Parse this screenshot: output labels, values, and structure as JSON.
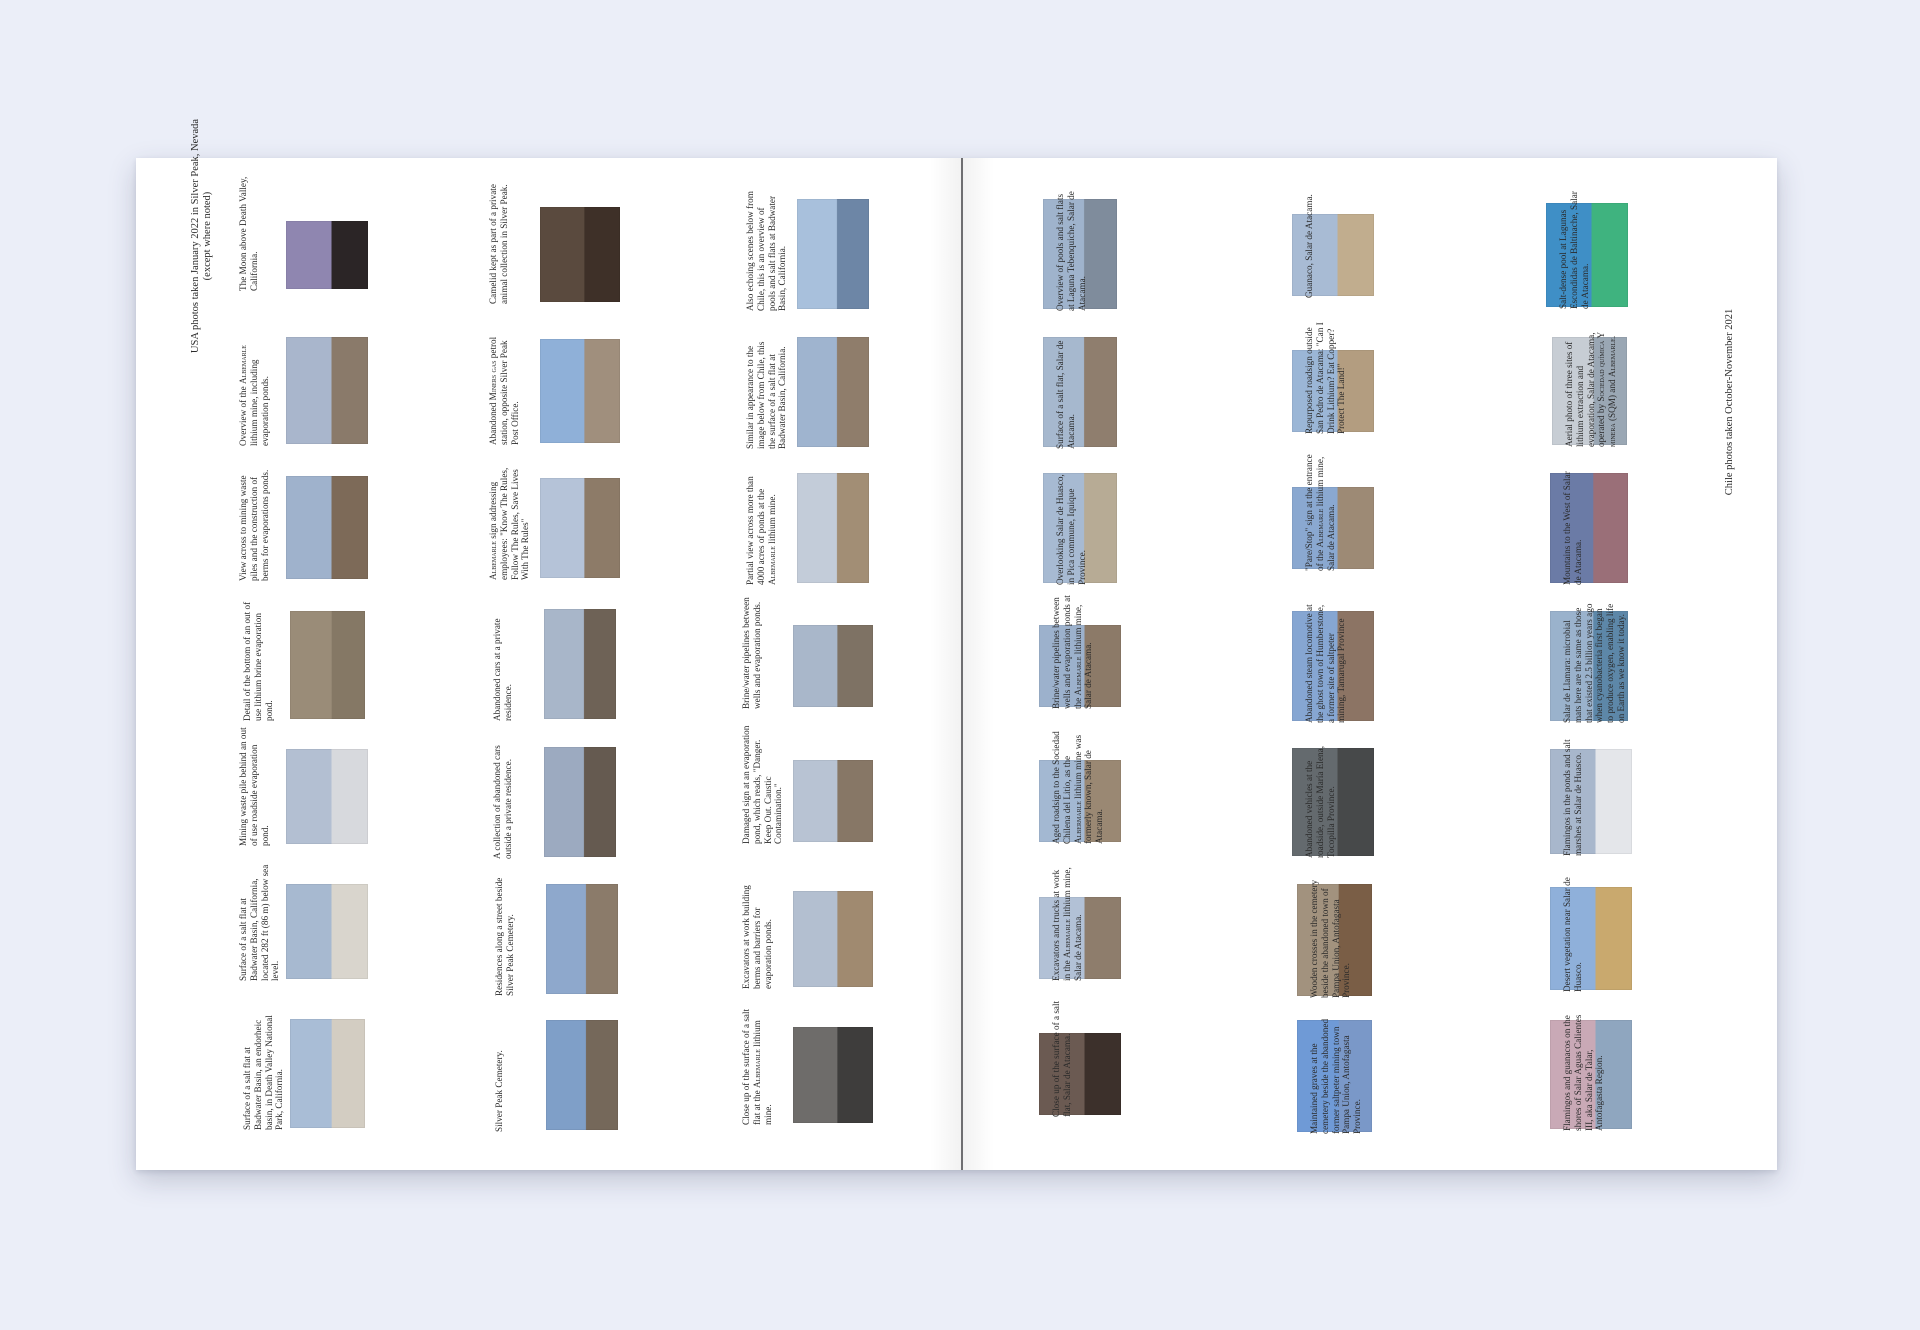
{
  "left_page": {
    "header_note": [
      "USA photos taken January 2022 in Silver Peak, Nevada",
      "(except where noted)"
    ],
    "items": [
      {
        "caption": "The Moon above Death Valley, California.",
        "photo": "moon-above-death-valley-photo",
        "sky": "#8f86b0",
        "ground": "#2b2526"
      },
      {
        "caption": "Overview of the ALBEMARLE lithium mine, including evaporation ponds.",
        "photo": "albemarle-mine-overview-photo",
        "sky": "#a9b6cc",
        "ground": "#8a7a6a"
      },
      {
        "caption": "View across to mining waste piles and the construction of berms for evaporations ponds.",
        "photo": "mining-waste-piles-view-photo",
        "sky": "#9fb2cc",
        "ground": "#7d6a58"
      },
      {
        "caption": "Detail of the bottom of an out of use lithium brine evaporation pond.",
        "photo": "evaporation-pond-bottom-photo",
        "sky": "#9a8c78",
        "ground": "#857865"
      },
      {
        "caption": "Mining waste pile behind an out of use roadside evaporation pond.",
        "photo": "roadside-evaporation-pond-photo",
        "sky": "#b3bfd2",
        "ground": "#d7d9dd"
      },
      {
        "caption": "Surface of a salt flat at Badwater Basin, California, located 282 ft (86 m) below sea level.",
        "photo": "badwater-basin-salt-flat-photo",
        "sky": "#a7b9d0",
        "ground": "#d9d5cd"
      },
      {
        "caption": "Surface of a salt flat at Badwater Basin, an endorheic basin, in Death Valley National Park, California.",
        "photo": "death-valley-salt-flat-photo",
        "sky": "#a9bdd6",
        "ground": "#d3cdc2"
      },
      {
        "caption": "Camelid kept as part of a private animal collection in Silver Peak.",
        "photo": "camelid-animal-collection-photo",
        "sky": "#5a4a3e",
        "ground": "#3e3028"
      },
      {
        "caption": "Abandoned MINERS GAS petrol station, opposite Silver Peak Post Office.",
        "photo": "abandoned-miners-gas-station-photo",
        "sky": "#8fb0d8",
        "ground": "#a08f7d"
      },
      {
        "caption": "ALBEMARLE sign addressing employees: \"Know The Rules, Follow The Rules, Save Lives With The Rules\"",
        "photo": "albemarle-sign-photo",
        "sky": "#b5c3d8",
        "ground": "#8d7b68"
      },
      {
        "caption": "Abandoned cars at a private residence.",
        "photo": "abandoned-cars-residence-photo",
        "sky": "#a8b6c9",
        "ground": "#6e6256"
      },
      {
        "caption": "A collection of abandoned cars outside a private residence.",
        "photo": "abandoned-cars-collection-photo",
        "sky": "#9caac0",
        "ground": "#655a50"
      },
      {
        "caption": "Residences along a street beside Silver Peak Cemetery.",
        "photo": "residences-street-photo",
        "sky": "#8ea8cc",
        "ground": "#8b7b6a"
      },
      {
        "caption": "Silver Peak Cemetery.",
        "photo": "silver-peak-cemetery-photo",
        "sky": "#7f9fc8",
        "ground": "#75685a"
      },
      {
        "caption": "Also echoing scenes below from Chile, this is an overview of pools and salt flats at Badwater Basin, California.",
        "photo": "badwater-pools-overview-photo",
        "sky": "#a8c0dc",
        "ground": "#6d86a6"
      },
      {
        "caption": "Similar in appearance to the image below from Chile, this the surface of a salt flat at Badwater Basin, California.",
        "photo": "badwater-surface-photo",
        "sky": "#9fb4cf",
        "ground": "#8f7d6b"
      },
      {
        "caption": "Partial view across more than 4000 acres of ponds at the ALBEMARLE lithium mine.",
        "photo": "albemarle-ponds-partial-view-photo",
        "sky": "#c3ccd9",
        "ground": "#a28e75"
      },
      {
        "caption": "Brine/water pipelines between wells and evaporation ponds.",
        "photo": "brine-water-pipelines-photo",
        "sky": "#a9b7ca",
        "ground": "#7e7264"
      },
      {
        "caption": "Damaged sign at an evaporation pond, which reads, \"Danger. Keep Out. Caustic Contamination.\"",
        "photo": "damaged-danger-sign-photo",
        "sky": "#b8c3d3",
        "ground": "#877766"
      },
      {
        "caption": "Excavators at work building berms and barriers for evaporation ponds.",
        "photo": "excavators-berms-photo",
        "sky": "#b3bfd0",
        "ground": "#a08a70"
      },
      {
        "caption": "Close up of the surface of a salt flat at the ALBEMARLE lithium mine.",
        "photo": "salt-flat-closeup-photo",
        "sky": "#6e6c6a",
        "ground": "#3e3d3c"
      }
    ]
  },
  "right_page": {
    "footer_note": "Chile photos taken October-November 2021",
    "items": [
      {
        "caption": "Overview of pools and salt flats at Laguna Tebenquiche, Salar de Atacama.",
        "photo": "laguna-tebenquiche-photo",
        "sky": "#9fb3cc",
        "ground": "#7f8c9c"
      },
      {
        "caption": "Surface of a salt flat, Salar de Atacama.",
        "photo": "salar-surface-photo",
        "sky": "#a6b8ce",
        "ground": "#8f7e6e"
      },
      {
        "caption": "Overlooking Salar de Huasco, in Pica commune, Iquique Province.",
        "photo": "salar-de-huasco-overlook-photo",
        "sky": "#a7bad2",
        "ground": "#b7ab95"
      },
      {
        "caption": "Brine/water pipelines between wells and evaporation ponds at the ALBEMARLE lithium mine, Salar de Atacama.",
        "photo": "atacama-pipelines-photo",
        "sky": "#9cb1cc",
        "ground": "#8c7a68"
      },
      {
        "caption": "Aged roadsign to the Sociedad Chilena del Litio, as the ALBERMARLE lithium mine was formerly known, Salar de Atacama.",
        "photo": "aged-roadsign-photo",
        "sky": "#a3b8d2",
        "ground": "#9a8873"
      },
      {
        "caption": "Excavators and trucks at work in the ALBEMARLE lithium mine, Salar de Atacama.",
        "photo": "excavators-trucks-photo",
        "sky": "#b2c1d6",
        "ground": "#8e7d6c"
      },
      {
        "caption": "Close up of the surface of a salt flat, Salar de Atacama.",
        "photo": "atacama-salt-closeup-photo",
        "sky": "#6b5a52",
        "ground": "#3c302b"
      },
      {
        "caption": "Guanaco, Salar de Atacama.",
        "photo": "guanaco-photo",
        "sky": "#a8bbd4",
        "ground": "#c1ad8e"
      },
      {
        "caption": "Repurposed roadsign outside San Pedro de Atacama: \"Can I Drink Lithium? Eat Copper? Protect The Land!\"",
        "photo": "repurposed-roadsign-photo",
        "sky": "#9bb6d6",
        "ground": "#b39d80"
      },
      {
        "caption": "\"Pare/Stop\" sign at the entrance of the ALBEMARLE lithium mine, Salar de Atacama.",
        "photo": "pare-stop-sign-photo",
        "sky": "#8aa8d0",
        "ground": "#9d8a75"
      },
      {
        "caption": "Abandoned steam locomotive at the ghost town of Humberstone, a former site of saltpeter mining, Tamarugal Province",
        "photo": "steam-locomotive-photo",
        "sky": "#86a6d2",
        "ground": "#8c7464"
      },
      {
        "caption": "Abandoned vehicles at the roadside, outside María Elena, Tocopilla Province.",
        "photo": "abandoned-vehicles-photo",
        "sky": "#646a6e",
        "ground": "#47494a"
      },
      {
        "caption": "Wooden crosses in the cemetery beside the abandoned town of Pampa Union, Antofagasta Province.",
        "photo": "wooden-crosses-photo",
        "sky": "#a2927e",
        "ground": "#7a5e46"
      },
      {
        "caption": "Maintained graves at the cemetery beside the abandoned former saltpeter mining town Pampa Union, Antofagasta Province.",
        "photo": "maintained-graves-photo",
        "sky": "#6f9ad6",
        "ground": "#7a98c8"
      },
      {
        "caption": "Salt-dense pool at Lagunas Escondidas de Baltinache, Salar de Atacama.",
        "photo": "salt-dense-pool-photo",
        "sky": "#3f8fc6",
        "ground": "#3fb37f"
      },
      {
        "caption": "Aerial photo of three sites of lithium extraction and evaporation, Salar de Atacama, operated by SOCIEDAD QUÍMICA Y MINERA (SQM) and ALBEMARLE.",
        "photo": "aerial-lithium-sites-photo",
        "sky": "#c7cdd4",
        "ground": "#9aa7b4"
      },
      {
        "caption": "Mountains to the West of Salar de Atacama.",
        "photo": "mountains-west-photo",
        "sky": "#6b7ba6",
        "ground": "#9a6f78"
      },
      {
        "caption": "Salar de Llamara: microbial mats here are the same as those that existed 2.5 billion years ago when cyanobacteria first began to produce oxygen, enabling life on Earth as we know it today.",
        "photo": "salar-de-llamara-photo",
        "sky": "#9ab2cc",
        "ground": "#5d87a8"
      },
      {
        "caption": "Flamingos in the ponds and salt marshes at Salar de Huasco.",
        "photo": "flamingos-ponds-photo",
        "sky": "#a8b7cc",
        "ground": "#e4e6ea"
      },
      {
        "caption": "Desert vegetation near Salar de Huasco.",
        "photo": "desert-vegetation-photo",
        "sky": "#8fb0da",
        "ground": "#c9a96e"
      },
      {
        "caption": "Flamingos and guanacos on the shores of Salar Aguas Calientes III, aka Salar de Talar, Antofagasta Region.",
        "photo": "flamingos-guanacos-photo",
        "sky": "#c9a9b6",
        "ground": "#8fa6bf"
      }
    ]
  }
}
